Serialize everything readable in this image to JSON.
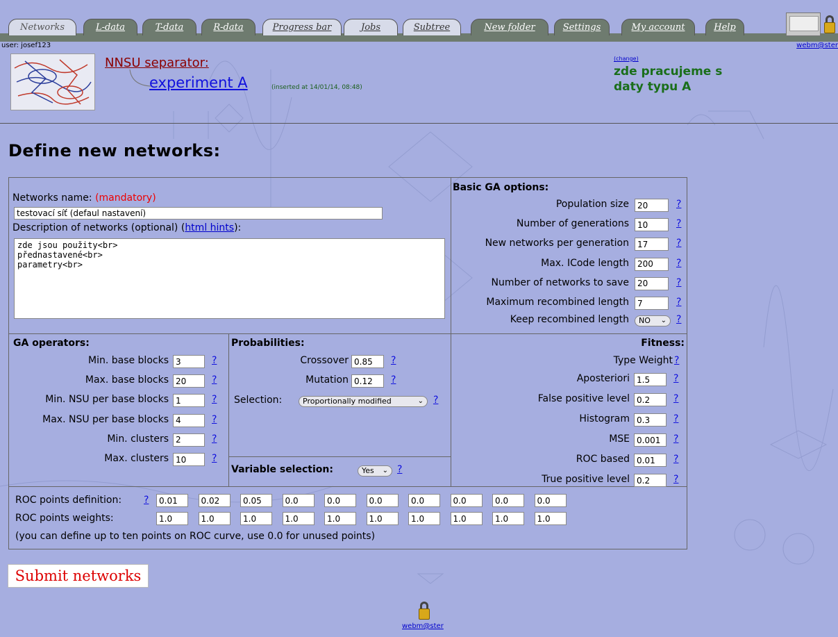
{
  "tabs": [
    {
      "label": "Networks",
      "style": "light"
    },
    {
      "label": "L-data",
      "style": "dark"
    },
    {
      "label": "T-data",
      "style": "dark"
    },
    {
      "label": "R-data",
      "style": "dark"
    },
    {
      "label": "Progress bar",
      "style": "light"
    },
    {
      "label": "Jobs",
      "style": "light"
    },
    {
      "label": "Subtree",
      "style": "light"
    },
    {
      "label": "New folder",
      "style": "dark"
    },
    {
      "label": "Settings",
      "style": "dark"
    },
    {
      "label": "My account",
      "style": "dark"
    },
    {
      "label": "Help",
      "style": "dark"
    }
  ],
  "user": "user: josef123",
  "webm": "webm@ster",
  "header": {
    "separator": "NNSU separator:",
    "experiment": "experiment A",
    "inserted": "(inserted at 14/01/14, 08:48)",
    "change": "(change)",
    "work_desc": "zde pracujeme s daty typu A"
  },
  "page_title": "Define new networks:",
  "name_section": {
    "label": "Networks name:",
    "mandatory": "(mandatory)",
    "name_value": "testovací síť (defaul nastavení)",
    "desc_label_pre": "Description of networks (optional) (",
    "desc_link": "html hints",
    "desc_label_post": "):",
    "desc_value": "zde jsou použity<br>\npřednastavené<br>\nparametry<br>"
  },
  "basic_ga": {
    "title": "Basic GA options:",
    "fields": [
      {
        "label": "Population size",
        "value": "20"
      },
      {
        "label": "Number of generations",
        "value": "10"
      },
      {
        "label": "New networks per generation",
        "value": "17"
      },
      {
        "label": "Max. ICode length",
        "value": "200"
      },
      {
        "label": "Number of networks to save",
        "value": "20"
      },
      {
        "label": "Maximum recombined length",
        "value": "7"
      }
    ],
    "keep_label": "Keep recombined length",
    "keep_value": "NO"
  },
  "ga_operators": {
    "title": "GA operators:",
    "fields": [
      {
        "label": "Min. base blocks",
        "value": "3"
      },
      {
        "label": "Max. base blocks",
        "value": "20"
      },
      {
        "label": "Min. NSU per base blocks",
        "value": "1"
      },
      {
        "label": "Max. NSU per base blocks",
        "value": "4"
      },
      {
        "label": "Min. clusters",
        "value": "2"
      },
      {
        "label": "Max. clusters",
        "value": "10"
      }
    ]
  },
  "probabilities": {
    "title": "Probabilities:",
    "crossover_label": "Crossover",
    "crossover_value": "0.85",
    "mutation_label": "Mutation",
    "mutation_value": "0.12",
    "selection_label": "Selection:",
    "selection_value": "Proportionally modified"
  },
  "variable_selection": {
    "label": "Variable selection:",
    "value": "Yes"
  },
  "fitness": {
    "title": "Fitness:",
    "type_label": "Type Weight",
    "fields": [
      {
        "label": "Aposteriori",
        "value": "1.5"
      },
      {
        "label": "False positive level",
        "value": "0.2"
      },
      {
        "label": "Histogram",
        "value": "0.3"
      },
      {
        "label": "MSE",
        "value": "0.001"
      },
      {
        "label": "ROC based",
        "value": "0.01"
      },
      {
        "label": "True positive level",
        "value": "0.2"
      }
    ]
  },
  "roc": {
    "def_label": "ROC points definition:",
    "weights_label": "ROC points weights:",
    "def_values": [
      "0.01",
      "0.02",
      "0.05",
      "0.0",
      "0.0",
      "0.0",
      "0.0",
      "0.0",
      "0.0",
      "0.0"
    ],
    "weight_values": [
      "1.0",
      "1.0",
      "1.0",
      "1.0",
      "1.0",
      "1.0",
      "1.0",
      "1.0",
      "1.0",
      "1.0"
    ],
    "note": "(you can define up to ten points on ROC curve, use 0.0 for unused points)"
  },
  "qmark": "?",
  "submit_label": "Submit networks"
}
